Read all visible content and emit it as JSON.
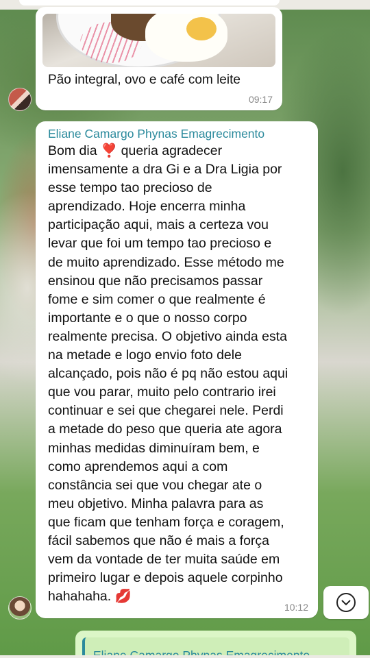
{
  "messages": [
    {
      "type": "photo",
      "caption": "Pão integral, ovo e café com leite",
      "time": "09:17"
    },
    {
      "type": "text",
      "sender": "Eliane Camargo Phynas Emagrecimento",
      "lines": [
        "Bom dia ❣️ queria agradecer",
        "imensamente a dra Gi e a Dra Ligia por",
        "esse tempo tao precioso de",
        "aprendizado.  Hoje encerra minha",
        "participação aqui, mais a certeza vou",
        "levar que foi um tempo tao precioso e",
        "de muito aprendizado. Esse método me",
        "ensinou que não precisamos passar",
        "fome e sim comer o que realmente é",
        "importante e o que o nosso corpo",
        "realmente precisa. O objetivo ainda esta",
        "na metade e logo envio foto dele",
        "alcançado, pois não é pq não estou aqui",
        "que vou parar, muito pelo contrario irei",
        "continuar e sei que chegarei nele.  Perdi",
        "a metade do peso que queria ate agora",
        "minhas medidas diminuíram bem, e",
        "como aprendemos aqui a com",
        "constância sei que vou chegar ate o",
        "meu objetivo.  Minha palavra para as",
        "que ficam que tenham força e coragem,",
        "fácil sabemos que não é mais a força",
        "vem da vontade de ter muita saúde em",
        "primeiro lugar e depois aquele corpinho",
        "hahahaha. 💋"
      ],
      "time": "10:12"
    },
    {
      "type": "outgoing-reply",
      "quoted_sender": "Eliane Camargo Phynas Emagrecimento"
    }
  ],
  "icons": {
    "scroll_down": "chevron-down-icon"
  },
  "colors": {
    "sender": "#2b8a9c",
    "bubble_incoming": "#ffffff",
    "bubble_outgoing": "#dcf6c7"
  }
}
